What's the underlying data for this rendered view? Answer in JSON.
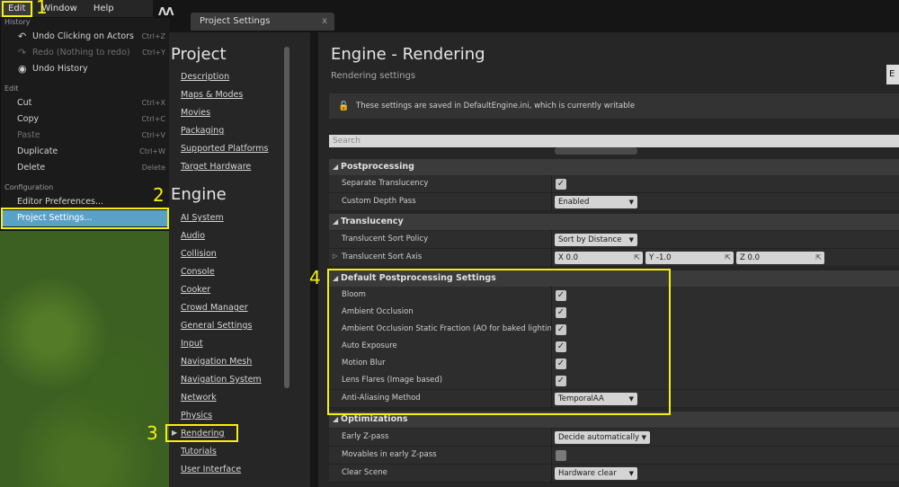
{
  "menubar": {
    "items": [
      {
        "label": "Edit",
        "active": true
      },
      {
        "label": "Window",
        "active": false
      },
      {
        "label": "Help",
        "active": false
      }
    ]
  },
  "tab": {
    "title": "Project Settings",
    "close_glyph": "x",
    "logo_text": "ɅɅ"
  },
  "edit_menu": {
    "history": {
      "header": "History",
      "items": [
        {
          "label": "Undo Clicking on Actors",
          "shortcut": "Ctrl+Z",
          "icon": "undo-icon",
          "enabled": true
        },
        {
          "label": "Redo (Nothing to redo)",
          "shortcut": "Ctrl+Y",
          "icon": "redo-icon",
          "enabled": false
        },
        {
          "label": "Undo History",
          "shortcut": "",
          "icon": "history-icon",
          "enabled": true
        }
      ]
    },
    "edit": {
      "header": "Edit",
      "items": [
        {
          "label": "Cut",
          "shortcut": "Ctrl+X",
          "enabled": true
        },
        {
          "label": "Copy",
          "shortcut": "Ctrl+C",
          "enabled": true
        },
        {
          "label": "Paste",
          "shortcut": "Ctrl+V",
          "enabled": false
        },
        {
          "label": "Duplicate",
          "shortcut": "Ctrl+W",
          "enabled": true
        },
        {
          "label": "Delete",
          "shortcut": "Delete",
          "enabled": true
        }
      ]
    },
    "configuration": {
      "header": "Configuration",
      "items": [
        {
          "label": "Editor Preferences...",
          "enabled": true
        },
        {
          "label": "Project Settings...",
          "enabled": true,
          "selected": true
        }
      ]
    }
  },
  "nav": {
    "project_heading": "Project",
    "project_links": [
      "Description",
      "Maps & Modes",
      "Movies",
      "Packaging",
      "Supported Platforms",
      "Target Hardware"
    ],
    "engine_heading": "Engine",
    "engine_links": [
      "AI System",
      "Audio",
      "Collision",
      "Console",
      "Cooker",
      "Crowd Manager",
      "General Settings",
      "Input",
      "Navigation Mesh",
      "Navigation System",
      "Network",
      "Physics",
      "Rendering",
      "Tutorials",
      "User Interface"
    ],
    "active_link": "Rendering"
  },
  "main": {
    "title": "Engine - Rendering",
    "subtitle": "Rendering settings",
    "edge_button": "E",
    "notice": "These settings are saved in DefaultEngine.ini, which is currently writable",
    "search_placeholder": "Search",
    "categories": {
      "postprocessing": {
        "label": "Postprocessing",
        "rows": [
          {
            "label": "Separate Translucency",
            "kind": "check",
            "checked": true
          },
          {
            "label": "Custom Depth Pass",
            "kind": "combo",
            "value": "Enabled"
          }
        ]
      },
      "translucency": {
        "label": "Translucency",
        "rows": [
          {
            "label": "Translucent Sort Policy",
            "kind": "combo",
            "value": "Sort by Distance"
          },
          {
            "label": "Translucent Sort Axis",
            "kind": "vector",
            "x": "X  0.0",
            "y": "Y  -1.0",
            "z": "Z  0.0"
          }
        ]
      },
      "default_pp": {
        "label": "Default Postprocessing Settings",
        "rows": [
          {
            "label": "Bloom",
            "kind": "check",
            "checked": true
          },
          {
            "label": "Ambient Occlusion",
            "kind": "check",
            "checked": true
          },
          {
            "label": "Ambient Occlusion Static Fraction (AO for baked lighting)",
            "kind": "check",
            "checked": true
          },
          {
            "label": "Auto Exposure",
            "kind": "check",
            "checked": true
          },
          {
            "label": "Motion Blur",
            "kind": "check",
            "checked": true
          },
          {
            "label": "Lens Flares (Image based)",
            "kind": "check",
            "checked": true
          },
          {
            "label": "Anti-Aliasing Method",
            "kind": "combo",
            "value": "TemporalAA"
          }
        ]
      },
      "optimizations": {
        "label": "Optimizations",
        "rows": [
          {
            "label": "Early Z-pass",
            "kind": "combo",
            "value": "Decide automatically"
          },
          {
            "label": "Movables in early Z-pass",
            "kind": "check",
            "checked": false
          },
          {
            "label": "Clear Scene",
            "kind": "combo",
            "value": "Hardware clear"
          }
        ]
      }
    }
  },
  "callouts": [
    "1",
    "2",
    "3",
    "4"
  ],
  "colors": {
    "highlight": "#f5f00e",
    "selection": "#5aa1c8"
  }
}
